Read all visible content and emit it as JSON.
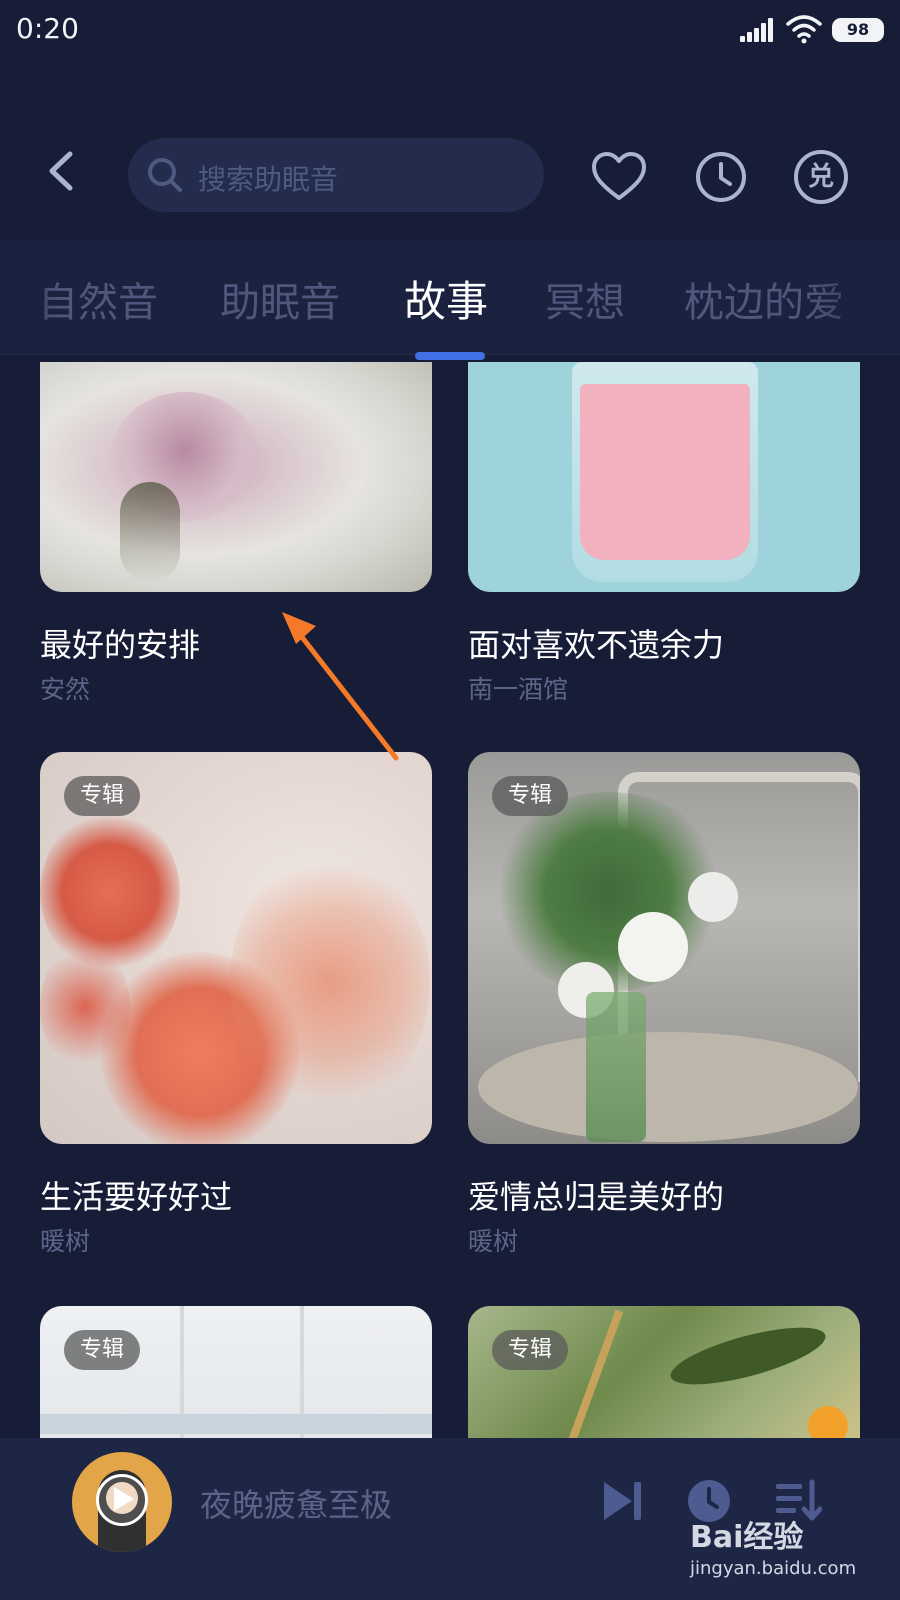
{
  "status_bar": {
    "time": "0:20",
    "battery": "98"
  },
  "header": {
    "search_placeholder": "搜索助眠音",
    "icons": [
      "back-icon",
      "search-icon",
      "heart-icon",
      "clock-icon",
      "redeem-icon"
    ],
    "redeem_label": "兑"
  },
  "tabs": [
    {
      "label": "自然音",
      "active": false
    },
    {
      "label": "助眠音",
      "active": false
    },
    {
      "label": "故事",
      "active": true
    },
    {
      "label": "冥想",
      "active": false
    },
    {
      "label": "枕边的爱",
      "active": false
    }
  ],
  "cards": [
    {
      "title": "最好的安排",
      "author": "安然",
      "badge": ""
    },
    {
      "title": "面对喜欢不遗余力",
      "author": "南一酒馆",
      "badge": ""
    },
    {
      "title": "生活要好好过",
      "author": "暖树",
      "badge": "专辑"
    },
    {
      "title": "爱情总归是美好的",
      "author": "暖树",
      "badge": "专辑"
    },
    {
      "title": "",
      "author": "",
      "badge": "专辑"
    },
    {
      "title": "",
      "author": "",
      "badge": "专辑"
    }
  ],
  "player": {
    "now_playing": "夜晚疲惫至极",
    "icons": [
      "play-icon",
      "next-icon",
      "timer-icon",
      "playlist-icon"
    ]
  },
  "watermark": {
    "brand": "Bai经验",
    "url": "jingyan.baidu.com"
  },
  "colors": {
    "background": "#171d36",
    "accent": "#4270e6",
    "annotation_arrow": "#f47a2a"
  }
}
